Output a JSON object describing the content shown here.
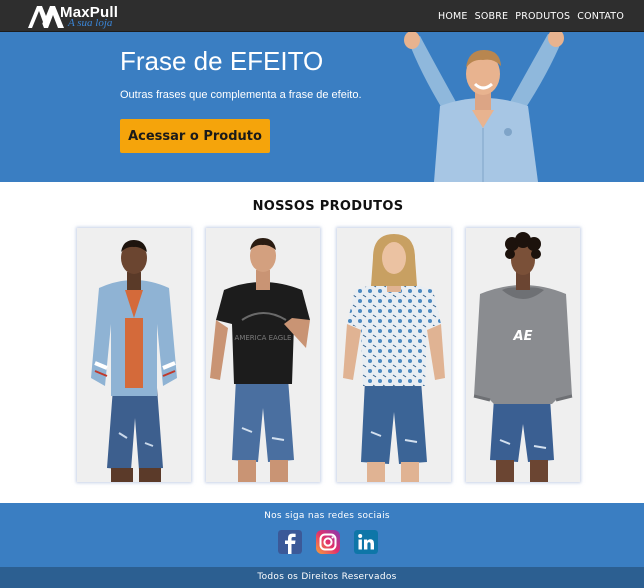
{
  "brand": {
    "name": "MaxPull",
    "tagline": "A sua loja",
    "logo_icon": "mp-monogram-icon"
  },
  "nav": {
    "items": [
      {
        "label": "HOME"
      },
      {
        "label": "SOBRE"
      },
      {
        "label": "PRODUTOS"
      },
      {
        "label": "CONTATO"
      }
    ]
  },
  "hero": {
    "title": "Frase de EFEITO",
    "subtitle": "Outras frases que complementa a frase de efeito.",
    "cta_label": "Acessar o Produto",
    "background_color": "#3a7ec2",
    "cta_color": "#f5a40b"
  },
  "products": {
    "title": "NOSSOS PRODUTOS",
    "items": [
      {
        "image": "model-light-blue-bomber-jacket",
        "shirt_text": ""
      },
      {
        "image": "model-black-graphic-tee",
        "shirt_text": "AMERICA EAGLE"
      },
      {
        "image": "model-patterned-short-sleeve-shirt",
        "shirt_text": ""
      },
      {
        "image": "model-gray-hoodie",
        "shirt_text": "AE"
      }
    ]
  },
  "footer": {
    "follow_text": "Nos siga nas redes sociais",
    "social": [
      {
        "icon": "facebook-icon",
        "color": "#3b5998"
      },
      {
        "icon": "instagram-icon",
        "color": "#c13584"
      },
      {
        "icon": "linkedin-icon",
        "color": "#0e76a8"
      }
    ],
    "copyright": "Todos os Direitos Reservados"
  }
}
